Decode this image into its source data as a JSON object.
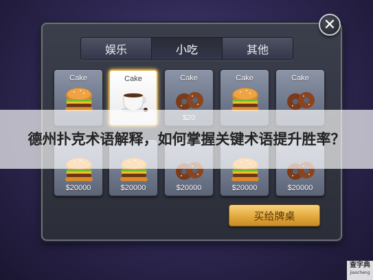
{
  "tabs": [
    {
      "label": "娱乐",
      "active": false
    },
    {
      "label": "小吃",
      "active": true
    },
    {
      "label": "其他",
      "active": false
    }
  ],
  "close_icon": "close-icon",
  "items": [
    {
      "name": "Cake",
      "price": "",
      "icon": "burger",
      "selected": false
    },
    {
      "name": "Cake",
      "price": "",
      "icon": "coffee",
      "selected": true
    },
    {
      "name": "Cake",
      "price": "$20",
      "icon": "donut",
      "selected": false
    },
    {
      "name": "Cake",
      "price": "",
      "icon": "burger",
      "selected": false
    },
    {
      "name": "Cake",
      "price": "",
      "icon": "donut",
      "selected": false
    },
    {
      "name": "",
      "price": "$20000",
      "icon": "burger",
      "selected": false
    },
    {
      "name": "",
      "price": "$20000",
      "icon": "burger",
      "selected": false
    },
    {
      "name": "",
      "price": "$20000",
      "icon": "donut",
      "selected": false
    },
    {
      "name": "",
      "price": "$20000",
      "icon": "burger",
      "selected": false
    },
    {
      "name": "",
      "price": "$20000",
      "icon": "donut",
      "selected": false
    }
  ],
  "buy_button": {
    "label": "买给牌桌"
  },
  "banner": {
    "title": "德州扑克术语解释，如何掌握关键术语提升胜率？"
  },
  "watermark": {
    "line1": "查字典",
    "line2": "jiaocheng"
  },
  "colors": {
    "accent_gold": "#e2a93e",
    "panel": "#3b3f4c",
    "background": "#2d2650"
  }
}
